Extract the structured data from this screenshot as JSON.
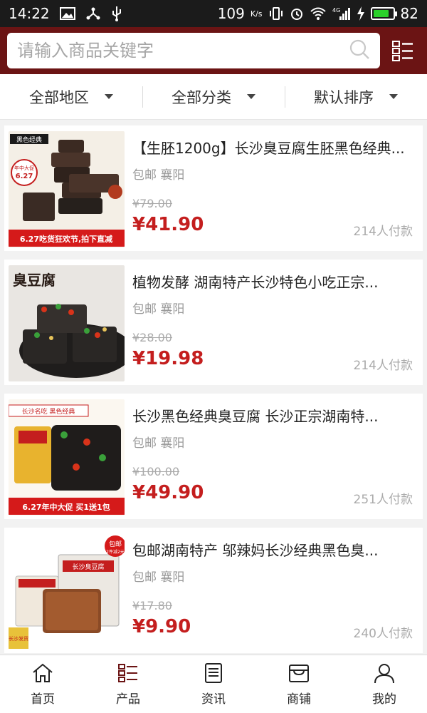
{
  "status": {
    "time": "14:22",
    "speed": "109",
    "speed_unit": "K/s",
    "network": "4G",
    "battery": "82",
    "battery_level": 0.82
  },
  "search": {
    "placeholder": "请输入商品关键字"
  },
  "filters": [
    {
      "label": "全部地区"
    },
    {
      "label": "全部分类"
    },
    {
      "label": "默认排序"
    }
  ],
  "products": [
    {
      "title": "【生胚1200g】长沙臭豆腐生胚黑色经典...",
      "shipping": "包邮",
      "location": "襄阳",
      "old_price": "¥79.00",
      "price": "¥41.90",
      "sold": "214人付款",
      "thumb": {
        "brand": "黑色经典",
        "badge_top": "年中大促",
        "badge_num": "6.27",
        "banner": "6.27吃货狂欢节,拍下直减"
      }
    },
    {
      "title": "植物发酵 湖南特产长沙特色小吃正宗...",
      "shipping": "包邮",
      "location": "襄阳",
      "old_price": "¥28.00",
      "price": "¥19.98",
      "sold": "214人付款",
      "thumb": {
        "text_a": "臭豆腐"
      }
    },
    {
      "title": "长沙黑色经典臭豆腐 长沙正宗湖南特...",
      "shipping": "包邮",
      "location": "襄阳",
      "old_price": "¥100.00",
      "price": "¥49.90",
      "sold": "251人付款",
      "thumb": {
        "brand": "长沙名吃 黑色经典",
        "banner": "6.27年中大促 买1送1包"
      }
    },
    {
      "title": "包邮湖南特产 邬辣妈长沙经典黑色臭...",
      "shipping": "包邮",
      "location": "襄阳",
      "old_price": "¥17.80",
      "price": "¥9.90",
      "sold": "240人付款",
      "thumb": {
        "badge": "包邮",
        "badge_sub": "2件减2元",
        "box": "长沙臭豆腐",
        "corner": "长沙发货"
      }
    }
  ],
  "nav": [
    {
      "label": "首页",
      "icon": "home-icon"
    },
    {
      "label": "产品",
      "icon": "list-icon"
    },
    {
      "label": "资讯",
      "icon": "news-icon"
    },
    {
      "label": "商铺",
      "icon": "shop-icon"
    },
    {
      "label": "我的",
      "icon": "user-icon"
    }
  ],
  "colors": {
    "header": "#6b1414",
    "price": "#c41e1e",
    "active_nav": "#6b1414"
  }
}
